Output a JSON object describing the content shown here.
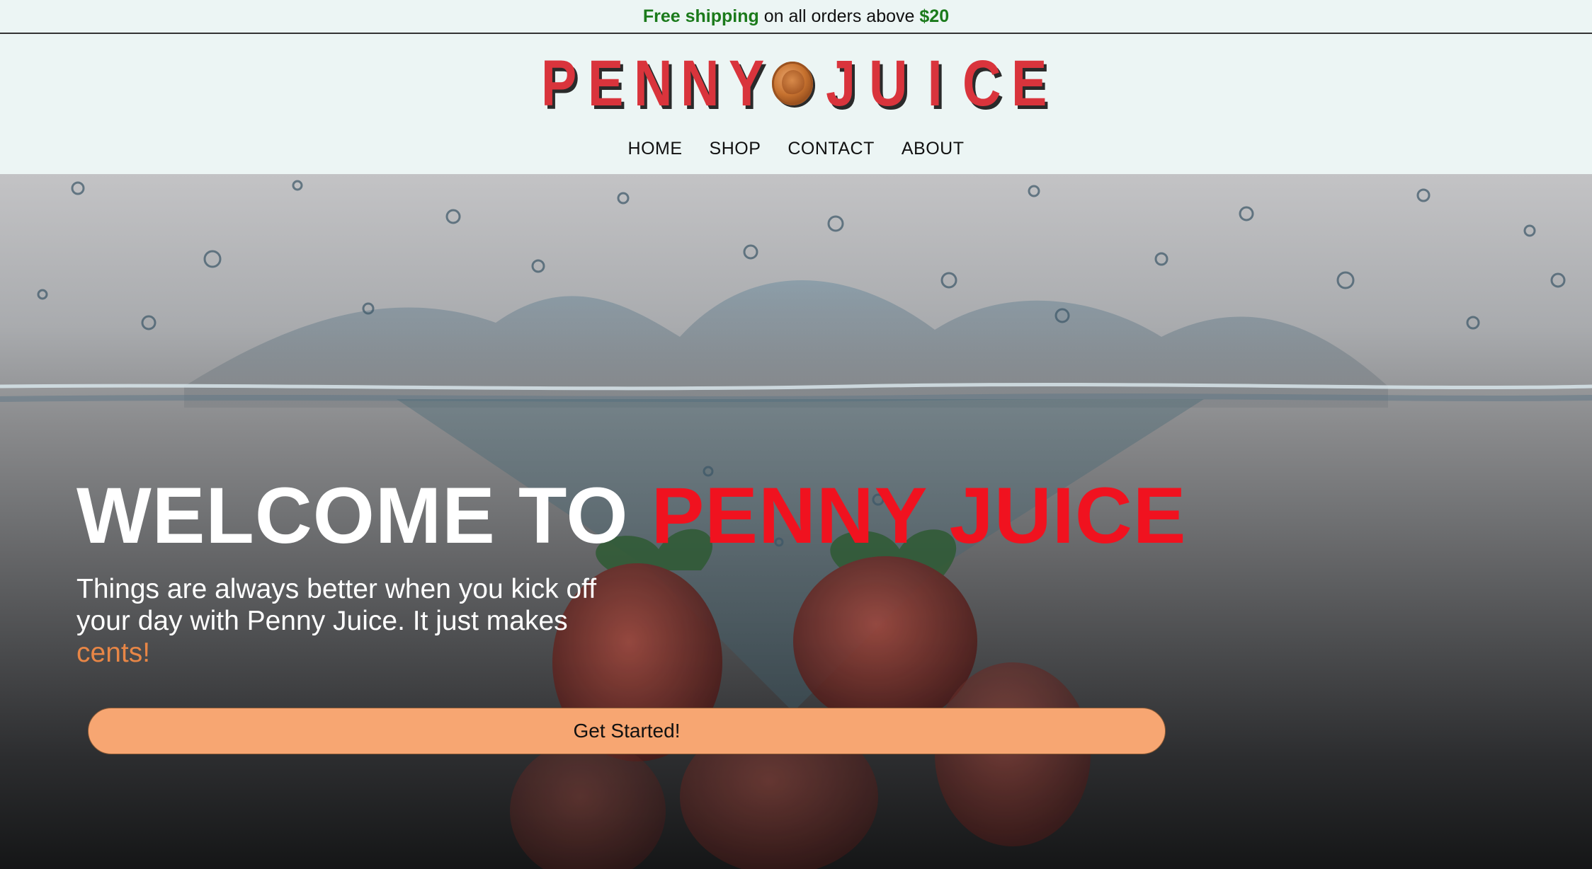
{
  "announcement": {
    "part1": "Free shipping",
    "part2": "on all orders above",
    "part3": "$20"
  },
  "brand": {
    "logo_left": [
      "P",
      "E",
      "N",
      "N",
      "Y"
    ],
    "logo_right": [
      "J",
      "U",
      "I",
      "C",
      "E"
    ],
    "logo_icon": "penny-coin-icon"
  },
  "nav": {
    "items": [
      "HOME",
      "SHOP",
      "CONTACT",
      "ABOUT"
    ]
  },
  "hero": {
    "title_white": "WELCOME TO",
    "title_red": "PENNY JUICE",
    "subtitle": "Things are always better when you kick off your day with Penny Juice. It just makes",
    "subtitle_accent": "cents!",
    "cta_label": "Get Started!",
    "background": "water-splash-strawberries"
  },
  "colors": {
    "background": "#ecf5f4",
    "brand_red": "#d9343c",
    "title_red": "#f0121f",
    "accent_orange": "#e88646",
    "cta": "#f7a672",
    "shipping_green": "#1b7a1b"
  }
}
